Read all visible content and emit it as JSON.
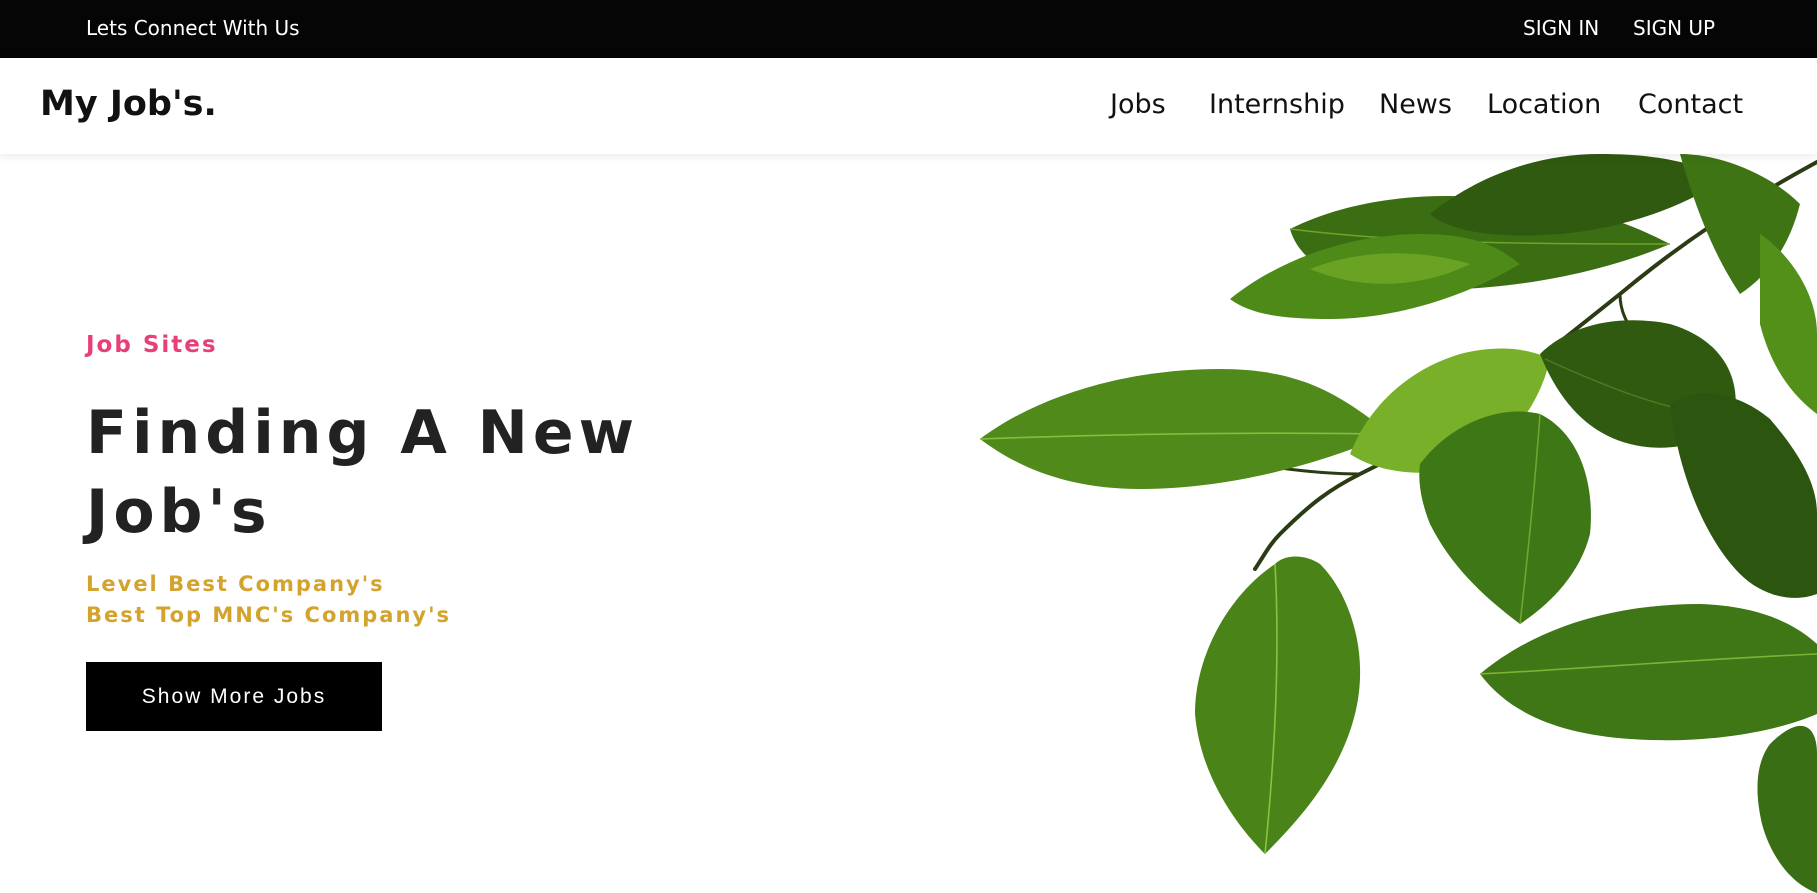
{
  "topbar": {
    "connect_text": "Lets Connect With Us",
    "sign_in": "SIGN IN",
    "sign_up": "SIGN UP"
  },
  "navbar": {
    "logo": "My Job's.",
    "links": [
      "Jobs",
      "Internship",
      "News",
      "Location",
      "Contact"
    ]
  },
  "hero": {
    "eyebrow": "Job Sites",
    "headline_line1": "Finding A New",
    "headline_line2": "Job's",
    "subtitle_line1": "Level Best Company's",
    "subtitle_line2": "Best Top MNC's Company's",
    "cta_label": "Show More Jobs",
    "image_icon": "green-leaves-branch"
  },
  "colors": {
    "topbar_bg": "#050505",
    "eyebrow": "#ea3e77",
    "headline": "#222222",
    "subtitle": "#d4a32d",
    "cta_bg": "#000000",
    "leaf_dark": "#2f5d10",
    "leaf_mid": "#4f8a1a",
    "leaf_light": "#7bb02a"
  }
}
